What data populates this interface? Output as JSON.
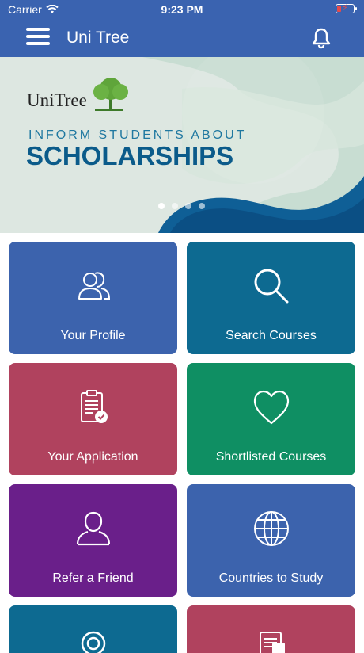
{
  "status": {
    "carrier": "Carrier",
    "time": "9:23 PM"
  },
  "appbar": {
    "title": "Uni Tree"
  },
  "banner": {
    "brand": "UniTree",
    "tagline": "INFORM STUDENTS ABOUT",
    "headline": "SCHOLARSHIPS",
    "slides": 4,
    "active_slide": 1
  },
  "tiles": [
    {
      "label": "Your Profile",
      "icon": "users-icon",
      "color": "#3c63ad"
    },
    {
      "label": "Search Courses",
      "icon": "search-icon",
      "color": "#0d6a91"
    },
    {
      "label": "Your Application",
      "icon": "clipboard-icon",
      "color": "#b0425e"
    },
    {
      "label": "Shortlisted Courses",
      "icon": "heart-icon",
      "color": "#0f8f63"
    },
    {
      "label": "Refer a Friend",
      "icon": "user-icon",
      "color": "#6a1f8a"
    },
    {
      "label": "Countries to Study",
      "icon": "globe-icon",
      "color": "#3c63ad"
    },
    {
      "label": "",
      "icon": "location-icon",
      "color": "#0d6a91"
    },
    {
      "label": "",
      "icon": "document-icon",
      "color": "#b0425e"
    }
  ],
  "colors": {
    "primary": "#3a63b0",
    "battery_low": "#e54b4b"
  }
}
